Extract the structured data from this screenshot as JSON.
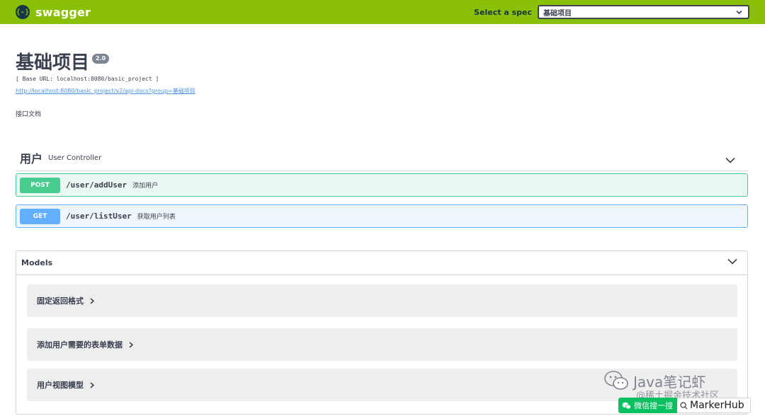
{
  "topbar": {
    "brand_logo": "{-}",
    "brand_name": "swagger",
    "spec_label": "Select a spec",
    "spec_value": "基础项目"
  },
  "info": {
    "title": "基础项目",
    "version": "2.0",
    "base_url": "[ Base URL: localhost:8080/basic_project ]",
    "docs_url": "http://localhost:8080/basic_project/v2/api-docs?group=基础项目",
    "description": "接口文档"
  },
  "tag": {
    "name": "用户",
    "description": "User Controller"
  },
  "operations": [
    {
      "method": "POST",
      "path": "/user/addUser",
      "summary": "添加用户"
    },
    {
      "method": "GET",
      "path": "/user/listUser",
      "summary": "获取用户列表"
    }
  ],
  "models": {
    "title": "Models",
    "items": [
      {
        "name": "固定返回格式"
      },
      {
        "name": "添加用户需要的表单数据"
      },
      {
        "name": "用户视图模型"
      }
    ]
  },
  "watermark": {
    "account": "Java笔记虾",
    "community": "@稀土掘金技术社区",
    "search_label": "微信搜一搜",
    "search_term": "MarkerHub"
  },
  "colors": {
    "topbar": "#89bf04",
    "post": "#49cc90",
    "get": "#61affe",
    "wechat_green": "#07c160"
  }
}
